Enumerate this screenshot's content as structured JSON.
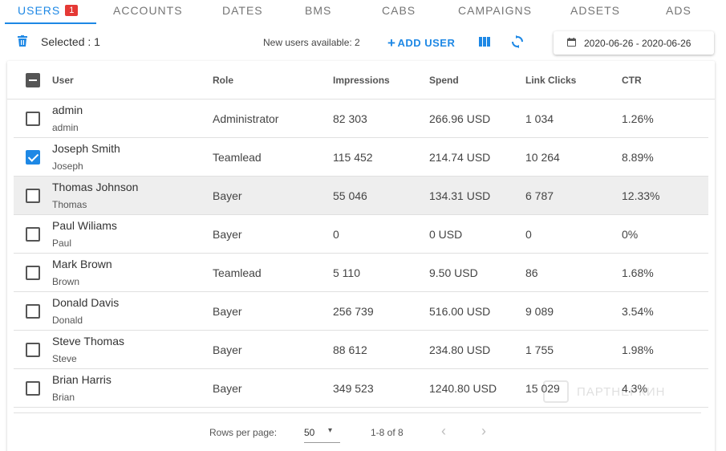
{
  "tabs": [
    {
      "label": "USERS",
      "badge": "1"
    },
    {
      "label": "ACCOUNTS"
    },
    {
      "label": "DATES"
    },
    {
      "label": "BMS"
    },
    {
      "label": "CABS"
    },
    {
      "label": "CAMPAIGNS"
    },
    {
      "label": "ADSETS"
    },
    {
      "label": "ADS"
    }
  ],
  "toolbar": {
    "selected_text": "Selected : 1",
    "new_users_text": "New users available: 2",
    "add_user_label": "ADD USER",
    "date_range": "2020-06-26 - 2020-06-26",
    "icons": [
      "trash-icon",
      "columns-icon",
      "refresh-icon",
      "calendar-icon"
    ]
  },
  "table": {
    "headers": [
      "User",
      "Role",
      "Impressions",
      "Spend",
      "Link Clicks",
      "CTR"
    ],
    "rows": [
      {
        "name": "admin",
        "login": "admin",
        "role": "Administrator",
        "impressions": "82 303",
        "spend": "266.96 USD",
        "link_clicks": "1 034",
        "ctr": "1.26%",
        "checked": false
      },
      {
        "name": "Joseph Smith",
        "login": "Joseph",
        "role": "Teamlead",
        "impressions": "115 452",
        "spend": "214.74 USD",
        "link_clicks": "10 264",
        "ctr": "8.89%",
        "checked": true
      },
      {
        "name": "Thomas Johnson",
        "login": "Thomas",
        "role": "Bayer",
        "impressions": "55 046",
        "spend": "134.31 USD",
        "link_clicks": "6 787",
        "ctr": "12.33%",
        "checked": false
      },
      {
        "name": "Paul Wiliams",
        "login": "Paul",
        "role": "Bayer",
        "impressions": "0",
        "spend": "0 USD",
        "link_clicks": "0",
        "ctr": "0%",
        "checked": false
      },
      {
        "name": "Mark Brown",
        "login": "Brown",
        "role": "Teamlead",
        "impressions": "5 110",
        "spend": "9.50 USD",
        "link_clicks": "86",
        "ctr": "1.68%",
        "checked": false
      },
      {
        "name": "Donald Davis",
        "login": "Donald",
        "role": "Bayer",
        "impressions": "256 739",
        "spend": "516.00 USD",
        "link_clicks": "9 089",
        "ctr": "3.54%",
        "checked": false
      },
      {
        "name": "Steve Thomas",
        "login": "Steve",
        "role": "Bayer",
        "impressions": "88 612",
        "spend": "234.80 USD",
        "link_clicks": "1 755",
        "ctr": "1.98%",
        "checked": false
      },
      {
        "name": "Brian Harris",
        "login": "Brian",
        "role": "Bayer",
        "impressions": "349 523",
        "spend": "1240.80 USD",
        "link_clicks": "15 029",
        "ctr": "4.3%",
        "checked": false
      }
    ]
  },
  "pagination": {
    "rows_per_page_label": "Rows per page:",
    "rows_per_page_value": "50",
    "page_info": "1-8 of 8"
  },
  "watermark": {
    "text": "ПАРТНЕРКИН"
  },
  "colors": {
    "accent": "#1e88e5",
    "badge": "#e53935",
    "hover_row": "#eeeeee"
  }
}
